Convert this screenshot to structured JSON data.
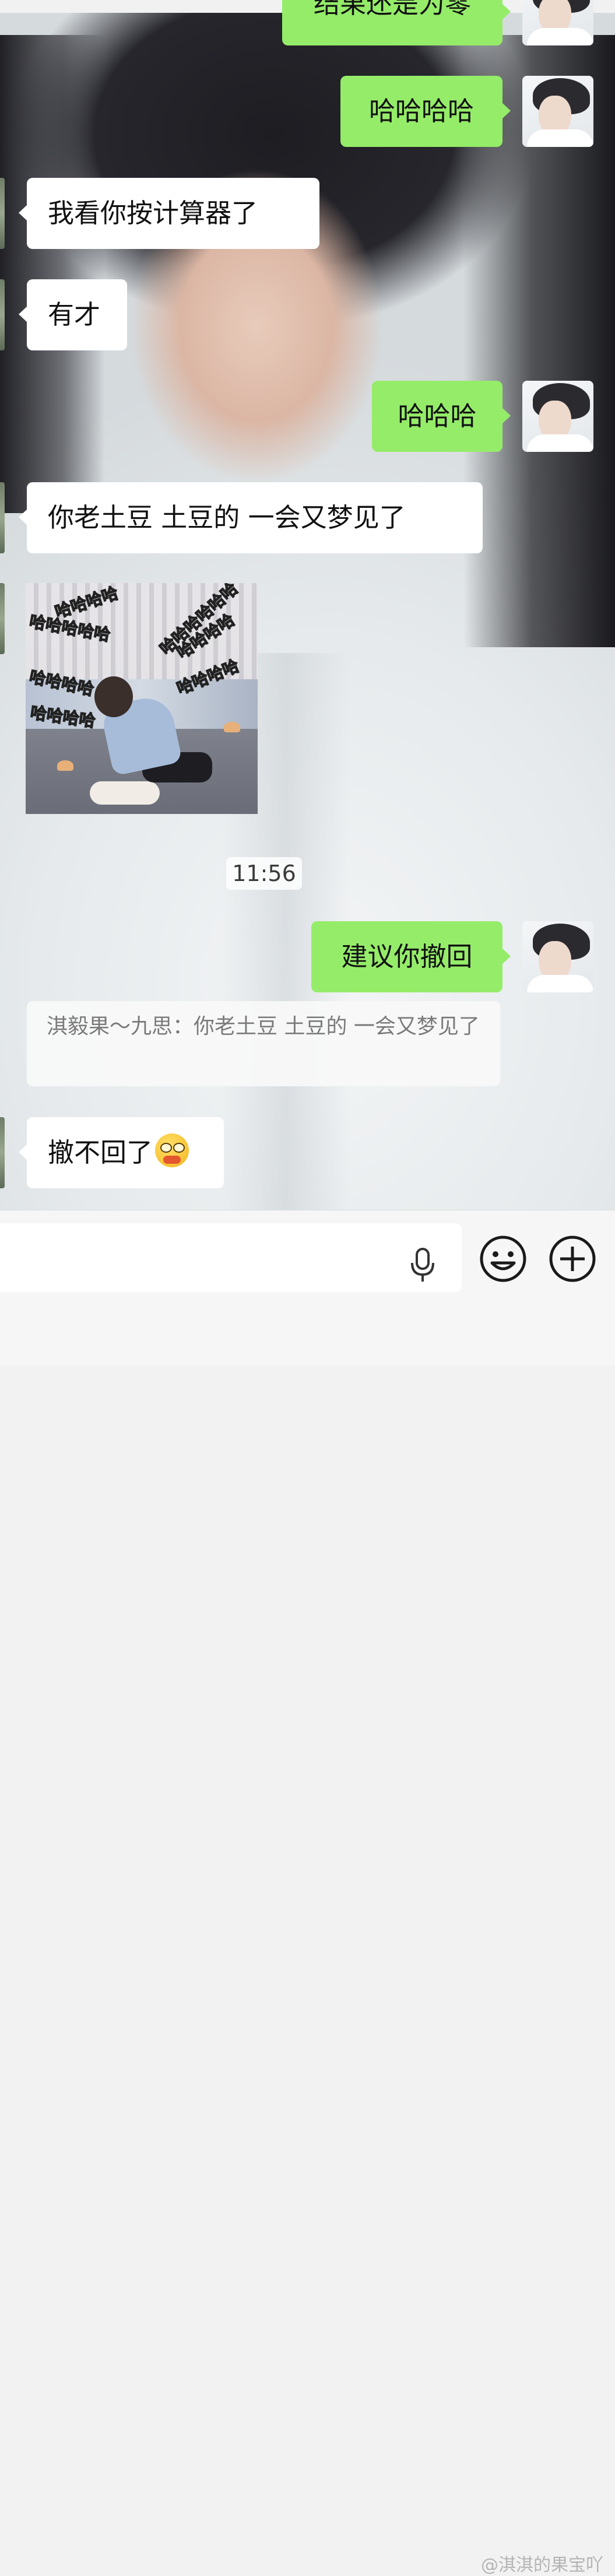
{
  "messages": {
    "m0_partial": "结果还是为零",
    "m1": "哈哈哈哈",
    "m2": "我看你按计算器了",
    "m3": "有才",
    "m4": "哈哈哈",
    "m5": "你老土豆 土豆的  一会又梦见了",
    "m7": "建议你撤回",
    "m8": "撤不回了"
  },
  "sticker": {
    "captions": [
      "哈哈哈哈",
      "哈哈哈哈哈",
      "哈哈哈哈哈哈",
      "哈哈哈哈",
      "哈哈哈哈",
      "哈哈哈哈",
      "哈哈哈哈"
    ]
  },
  "timestamp": "11:56",
  "quote": {
    "text": "淇毅果～九思：你老土豆 土豆的  一会又梦见了"
  },
  "input": {
    "placeholder": ""
  },
  "icons": {
    "mic": "microphone-icon",
    "emoji": "smiley-icon",
    "plus": "plus-circle-icon",
    "inline_emoji": "emoji-face-with-glasses"
  },
  "colors": {
    "outgoing_bubble": "#95ec69",
    "incoming_bubble": "#ffffff",
    "input_bar": "#f6f6f6"
  },
  "watermark": "@淇淇的果宝吖"
}
